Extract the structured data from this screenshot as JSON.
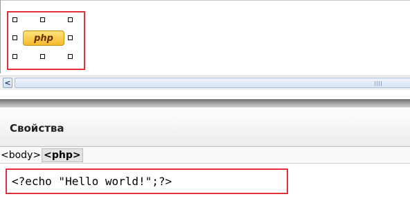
{
  "design_view": {
    "php_tag_label": "php"
  },
  "scrollbar": {
    "left_arrow": "<",
    "grip": "|||"
  },
  "properties_panel": {
    "title": "Свойства",
    "tag_selector": {
      "crumbs": [
        "<body>",
        "<php>"
      ],
      "active": "<php>"
    },
    "code": "<?echo \"Hello world!\";?>"
  },
  "colors": {
    "highlight_border": "#e0303a",
    "php_tag_fill": "#f3bb2c"
  },
  "icons": {
    "left_arrow": "chevron-left-icon"
  }
}
